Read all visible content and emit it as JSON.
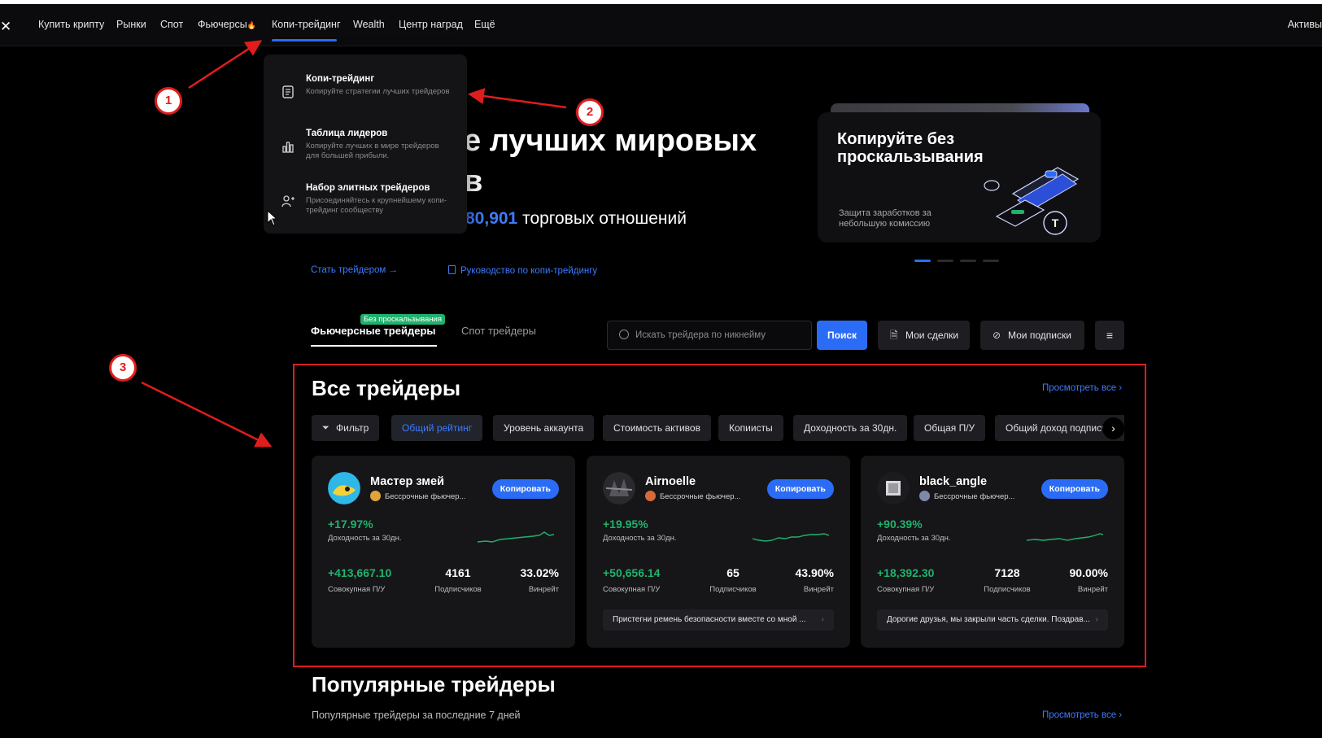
{
  "nav": {
    "logo": "✕",
    "items": [
      "Купить крипту",
      "Рынки",
      "Спот",
      "Фьючерсы",
      "Копи-трейдинг",
      "Wealth",
      "Центр наград",
      "Ещё"
    ],
    "fire": "🔥",
    "right": "Активы"
  },
  "dropdown": {
    "items": [
      {
        "title": "Копи-трейдинг",
        "desc": "Копируйте стратегии лучших трейдеров",
        "icon": "copy-doc-icon"
      },
      {
        "title": "Таблица лидеров",
        "desc": "Копируйте лучших в мире трейдеров для большей прибыли.",
        "icon": "bar-chart-icon"
      },
      {
        "title": "Набор элитных трейдеров",
        "desc": "Присоединяйтесь к крупнейшему копи-трейдинг сообществу",
        "icon": "user-add-icon"
      }
    ]
  },
  "hero": {
    "title_line1": "е лучших мировых",
    "title_line2": "в",
    "count": "80,901",
    "count_suffix": " торговых отношений",
    "link_trader": "Стать трейдером →",
    "link_guide": "Руководство по копи-трейдингу"
  },
  "promo": {
    "title": "Копируйте без проскальзывания",
    "desc": "Защита заработков за небольшую комиссию"
  },
  "tabs": {
    "futures": "Фьючерсные трейдеры",
    "badge": "Без проскальзывания",
    "spot": "Спот трейдеры"
  },
  "search": {
    "placeholder": "Искать трейдера по никнейму",
    "button": "Поиск"
  },
  "buttons": {
    "my_deals": "Мои сделки",
    "my_subs": "Мои подписки",
    "menu": "≡"
  },
  "all_traders": {
    "title": "Все трейдеры",
    "view_all": "Просмотреть все ›",
    "chips": [
      "Фильтр",
      "Общий рейтинг",
      "Уровень аккаунта",
      "Стоимость активов",
      "Копиисты",
      "Доходность за 30дн.",
      "Общая П/У",
      "Общий доход подписч"
    ],
    "active_chip": "Общий рейтинг"
  },
  "cards": [
    {
      "name": "Мастер змей",
      "tag": "Бессрочные фьючер...",
      "copy": "Копировать",
      "pct": "+17.97%",
      "pct_label": "Доходность за 30дн.",
      "pnl": "+413,667.10",
      "pnl_label": "Совокупная П/У",
      "subs": "4161",
      "subs_label": "Подписчиков",
      "win": "33.02%",
      "win_label": "Винрейт",
      "msg": ""
    },
    {
      "name": "Airnoelle",
      "tag": "Бессрочные фьючер...",
      "copy": "Копировать",
      "pct": "+19.95%",
      "pct_label": "Доходность за 30дн.",
      "pnl": "+50,656.14",
      "pnl_label": "Совокупная П/У",
      "subs": "65",
      "subs_label": "Подписчиков",
      "win": "43.90%",
      "win_label": "Винрейт",
      "msg": "Пристегни ремень безопасности вместе со мной ..."
    },
    {
      "name": "black_angle",
      "tag": "Бессрочные фьючер...",
      "copy": "Копировать",
      "pct": "+90.39%",
      "pct_label": "Доходность за 30дн.",
      "pnl": "+18,392.30",
      "pnl_label": "Совокупная П/У",
      "subs": "7128",
      "subs_label": "Подписчиков",
      "win": "90.00%",
      "win_label": "Винрейт",
      "msg": "Дорогие друзья, мы закрыли часть сделки. Поздрав..."
    }
  ],
  "popular": {
    "title": "Популярные трейдеры",
    "subtitle": "Популярные трейдеры за последние 7 дней",
    "view_all": "Просмотреть все ›"
  },
  "annotations": [
    "1",
    "2",
    "3"
  ],
  "colors": {
    "accent": "#2b6cf6",
    "positive": "#20b26c",
    "annotation": "#e01d1d",
    "background": "#000000"
  }
}
